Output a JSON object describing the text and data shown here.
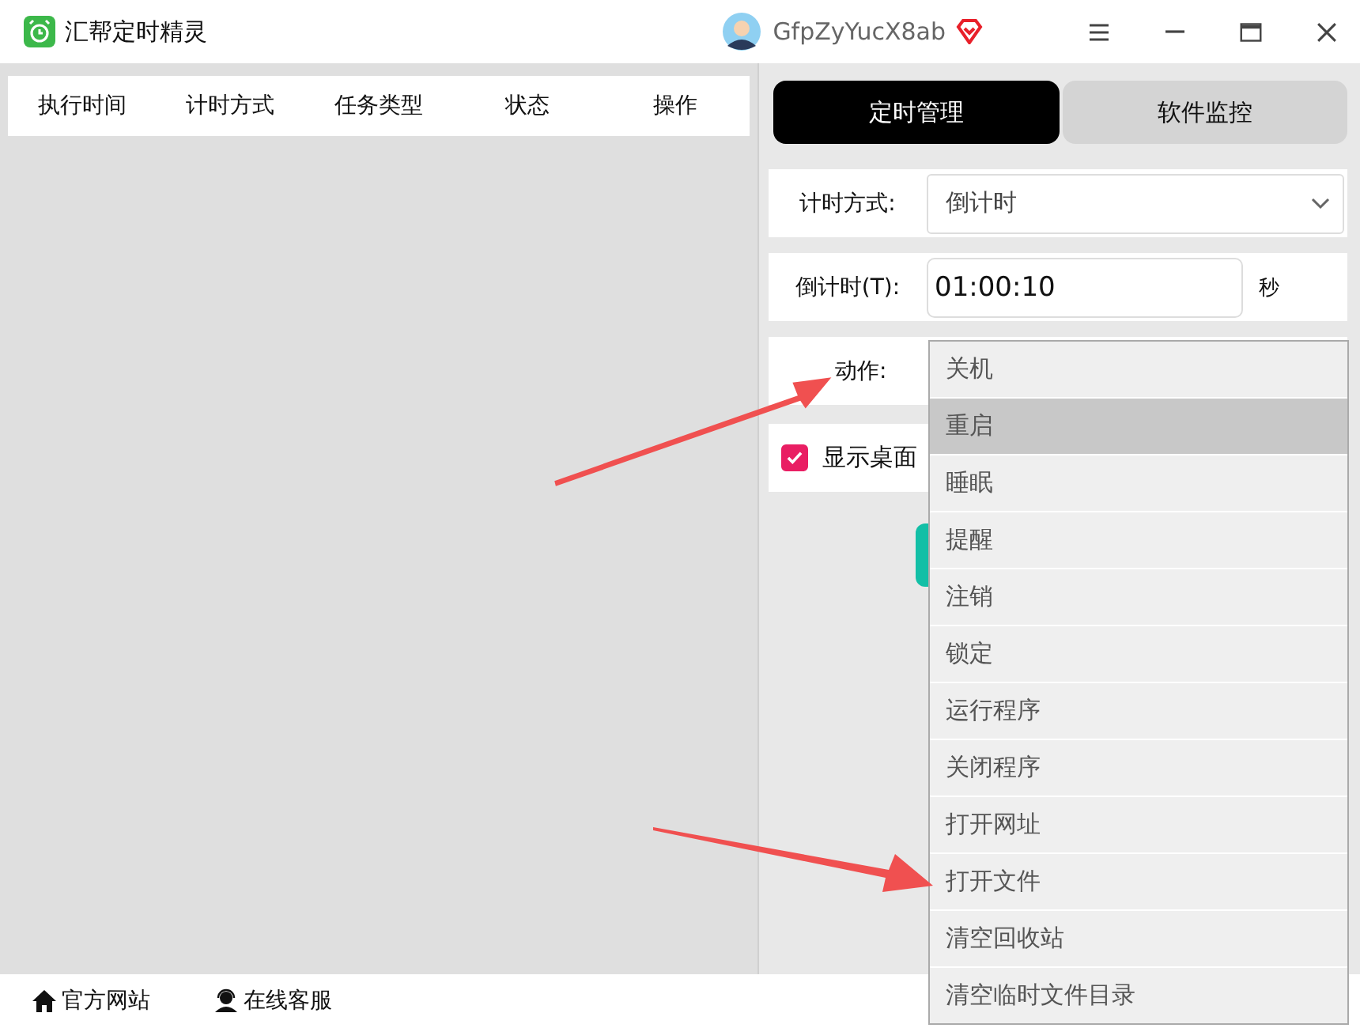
{
  "window": {
    "title": "汇帮定时精灵",
    "username": "GfpZyYucX8ab"
  },
  "table": {
    "columns": [
      "执行时间",
      "计时方式",
      "任务类型",
      "状态",
      "操作"
    ]
  },
  "tabs": [
    {
      "label": "定时管理",
      "selected": true
    },
    {
      "label": "软件监控",
      "selected": false
    }
  ],
  "form": {
    "timing_mode": {
      "label": "计时方式:",
      "value": "倒计时"
    },
    "countdown": {
      "label": "倒计时(T):",
      "value": "01:00:10",
      "unit": "秒"
    },
    "action": {
      "label": "动作:"
    },
    "show_desktop": {
      "label": "显示桌面",
      "checked": true
    }
  },
  "action_menu": [
    {
      "label": "关机",
      "selected": false
    },
    {
      "label": "重启",
      "selected": true
    },
    {
      "label": "睡眠",
      "selected": false
    },
    {
      "label": "提醒",
      "selected": false
    },
    {
      "label": "注销",
      "selected": false
    },
    {
      "label": "锁定",
      "selected": false
    },
    {
      "label": "运行程序",
      "selected": false
    },
    {
      "label": "关闭程序",
      "selected": false
    },
    {
      "label": "打开网址",
      "selected": false
    },
    {
      "label": "打开文件",
      "selected": false
    },
    {
      "label": "清空回收站",
      "selected": false
    },
    {
      "label": "清空临时文件目录",
      "selected": false
    }
  ],
  "footer": {
    "links": [
      "官方网站",
      "在线客服"
    ]
  }
}
